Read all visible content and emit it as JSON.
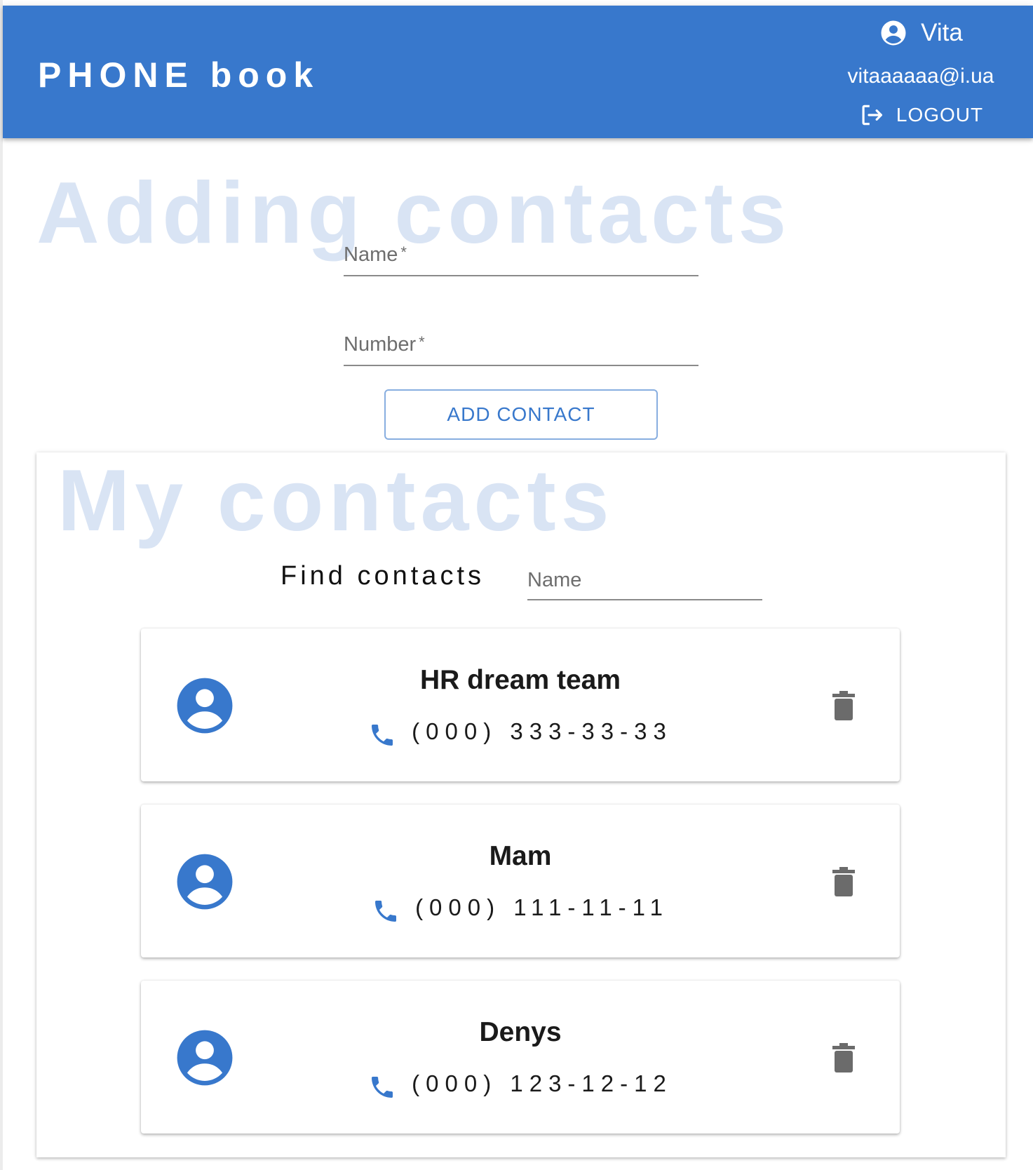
{
  "header": {
    "brand": "PHONE book",
    "user_name": "Vita",
    "user_email": "vitaaaaaa@i.ua",
    "logout_label": "LOGOUT",
    "background_color": "#3878cc",
    "icons": {
      "user": "account-circle-icon",
      "logout": "logout-icon"
    }
  },
  "add_form": {
    "title": "Adding contacts",
    "name_label": "Name",
    "number_label": "Number",
    "required_mark": "*",
    "name_value": "",
    "number_value": "",
    "submit_label": "ADD CONTACT"
  },
  "contacts_section": {
    "title": "My contacts",
    "filter_label": "Find contacts",
    "filter_placeholder": "Name",
    "filter_value": ""
  },
  "contacts": [
    {
      "name": "HR dream team",
      "number": "(000) 333-33-33"
    },
    {
      "name": "Mam",
      "number": "(000) 111-11-11"
    },
    {
      "name": "Denys",
      "number": "(000) 123-12-12"
    }
  ],
  "colors": {
    "accent": "#3878cc",
    "watermark": "#d9e4f4",
    "delete_icon": "#6b6b6b"
  }
}
